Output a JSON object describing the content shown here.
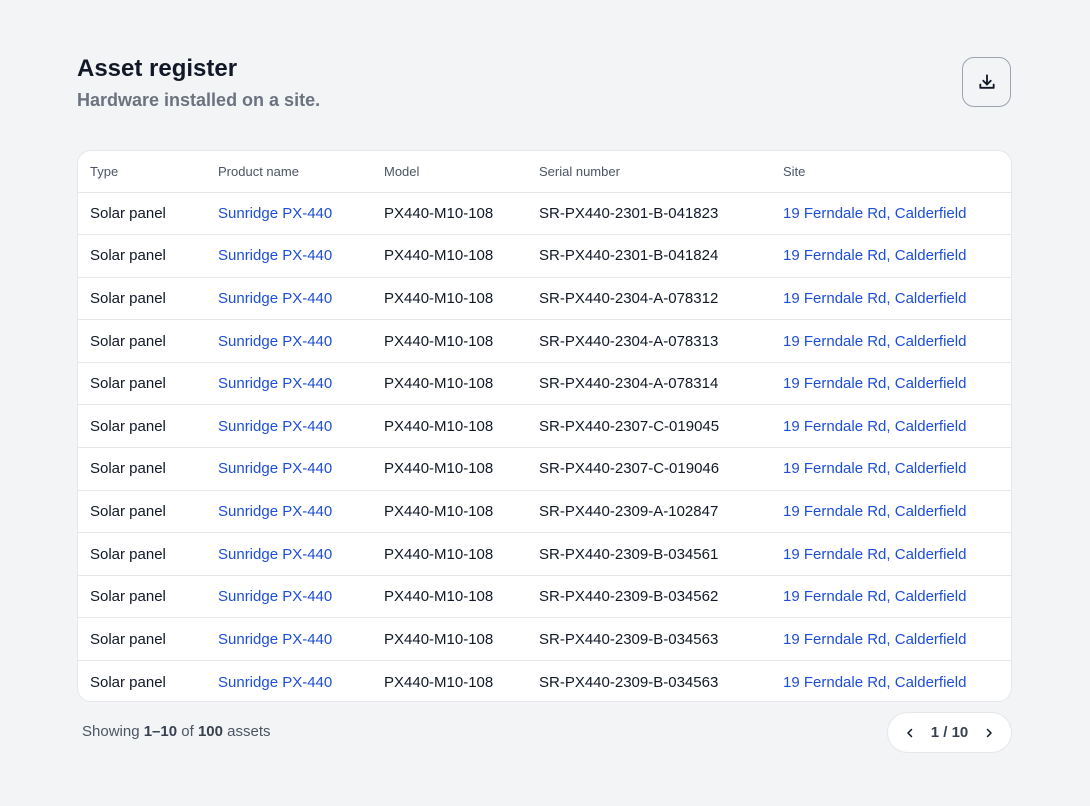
{
  "header": {
    "title": "Asset register",
    "subtitle": "Hardware installed on a site."
  },
  "icons": {
    "download": "download-icon",
    "prev": "chevron-left-icon",
    "next": "chevron-right-icon"
  },
  "colors": {
    "link": "#1d4ed8",
    "background": "#f3f4f6"
  },
  "table": {
    "columns": [
      "Type",
      "Product name",
      "Model",
      "Serial number",
      "Site"
    ],
    "rows": [
      {
        "type": "Solar panel",
        "product": "Sunridge PX-440",
        "model": "PX440-M10-108",
        "serial": "SR-PX440-2301-B-041823",
        "site": "19 Ferndale Rd, Calderfield"
      },
      {
        "type": "Solar panel",
        "product": "Sunridge PX-440",
        "model": "PX440-M10-108",
        "serial": "SR-PX440-2301-B-041824",
        "site": "19 Ferndale Rd, Calderfield"
      },
      {
        "type": "Solar panel",
        "product": "Sunridge PX-440",
        "model": "PX440-M10-108",
        "serial": "SR-PX440-2304-A-078312",
        "site": "19 Ferndale Rd, Calderfield"
      },
      {
        "type": "Solar panel",
        "product": "Sunridge PX-440",
        "model": "PX440-M10-108",
        "serial": "SR-PX440-2304-A-078313",
        "site": "19 Ferndale Rd, Calderfield"
      },
      {
        "type": "Solar panel",
        "product": "Sunridge PX-440",
        "model": "PX440-M10-108",
        "serial": "SR-PX440-2304-A-078314",
        "site": "19 Ferndale Rd, Calderfield"
      },
      {
        "type": "Solar panel",
        "product": "Sunridge PX-440",
        "model": "PX440-M10-108",
        "serial": "SR-PX440-2307-C-019045",
        "site": "19 Ferndale Rd, Calderfield"
      },
      {
        "type": "Solar panel",
        "product": "Sunridge PX-440",
        "model": "PX440-M10-108",
        "serial": "SR-PX440-2307-C-019046",
        "site": "19 Ferndale Rd, Calderfield"
      },
      {
        "type": "Solar panel",
        "product": "Sunridge PX-440",
        "model": "PX440-M10-108",
        "serial": "SR-PX440-2309-A-102847",
        "site": "19 Ferndale Rd, Calderfield"
      },
      {
        "type": "Solar panel",
        "product": "Sunridge PX-440",
        "model": "PX440-M10-108",
        "serial": "SR-PX440-2309-B-034561",
        "site": "19 Ferndale Rd, Calderfield"
      },
      {
        "type": "Solar panel",
        "product": "Sunridge PX-440",
        "model": "PX440-M10-108",
        "serial": "SR-PX440-2309-B-034562",
        "site": "19 Ferndale Rd, Calderfield"
      },
      {
        "type": "Solar panel",
        "product": "Sunridge PX-440",
        "model": "PX440-M10-108",
        "serial": "SR-PX440-2309-B-034563",
        "site": "19 Ferndale Rd, Calderfield"
      },
      {
        "type": "Solar panel",
        "product": "Sunridge PX-440",
        "model": "PX440-M10-108",
        "serial": "SR-PX440-2309-B-034563",
        "site": "19 Ferndale Rd, Calderfield"
      }
    ]
  },
  "footer": {
    "prefix": "Showing",
    "range": "1–10",
    "of": "of",
    "total": "100",
    "suffix": "assets"
  },
  "pagination": {
    "label": "1 / 10"
  }
}
